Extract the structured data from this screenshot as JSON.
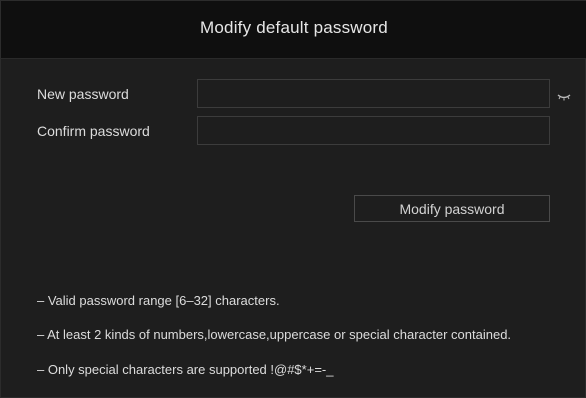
{
  "dialog": {
    "title": "Modify default password"
  },
  "form": {
    "new_password": {
      "label": "New password",
      "value": "",
      "placeholder": ""
    },
    "confirm_password": {
      "label": "Confirm password",
      "value": "",
      "placeholder": ""
    },
    "show_password_icon": "eye-closed-icon",
    "submit_label": "Modify password"
  },
  "hints": [
    "– Valid password range [6–32] characters.",
    "– At least 2 kinds of numbers,lowercase,uppercase or special character contained.",
    "– Only special characters are supported !@#$*+=-_"
  ],
  "colors": {
    "background": "#1e1e1e",
    "title_bar": "#0f0f0f",
    "text": "#dcdcdc",
    "input_border": "#3c3c3c"
  }
}
